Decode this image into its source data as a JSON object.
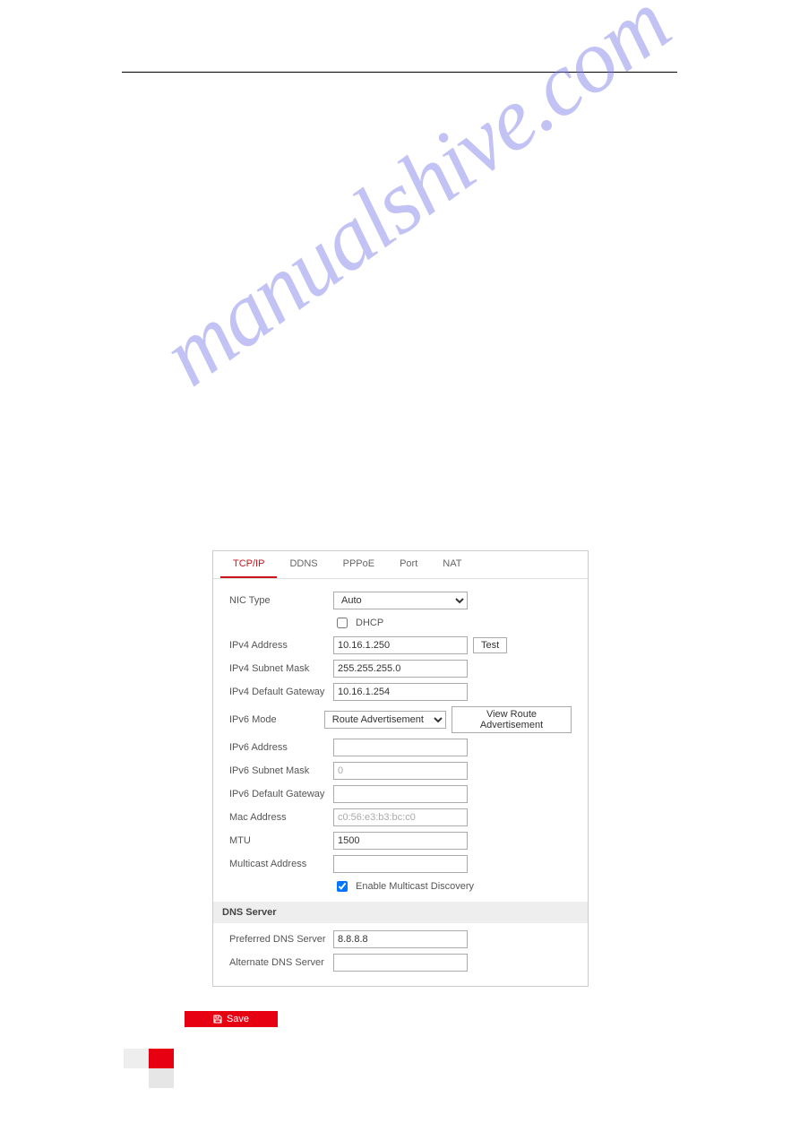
{
  "watermark": "manualshive.com",
  "panel": {
    "tabs": {
      "tcpip": "TCP/IP",
      "ddns": "DDNS",
      "pppoe": "PPPoE",
      "port": "Port",
      "nat": "NAT"
    },
    "labels": {
      "nic_type": "NIC Type",
      "dhcp": "DHCP",
      "ipv4_address": "IPv4 Address",
      "ipv4_subnet": "IPv4 Subnet Mask",
      "ipv4_gateway": "IPv4 Default Gateway",
      "ipv6_mode": "IPv6 Mode",
      "ipv6_address": "IPv6 Address",
      "ipv6_subnet": "IPv6 Subnet Mask",
      "ipv6_gateway": "IPv6 Default Gateway",
      "mac_address": "Mac Address",
      "mtu": "MTU",
      "multicast_address": "Multicast Address",
      "enable_multicast_discovery": "Enable Multicast Discovery",
      "dns_server_header": "DNS Server",
      "preferred_dns": "Preferred DNS Server",
      "alternate_dns": "Alternate DNS Server"
    },
    "buttons": {
      "test": "Test",
      "view_route_adv": "View Route Advertisement"
    },
    "values": {
      "nic_type": "Auto",
      "dhcp_checked": false,
      "ipv4_address": "10.16.1.250",
      "ipv4_subnet": "255.255.255.0",
      "ipv4_gateway": "10.16.1.254",
      "ipv6_mode": "Route Advertisement",
      "ipv6_address": "",
      "ipv6_subnet": "0",
      "ipv6_gateway": "",
      "mac_address": "c0:56:e3:b3:bc:c0",
      "mtu": "1500",
      "multicast_address": "",
      "enable_multicast_discovery_checked": true,
      "preferred_dns": "8.8.8.8",
      "alternate_dns": ""
    }
  },
  "save_label": "Save"
}
